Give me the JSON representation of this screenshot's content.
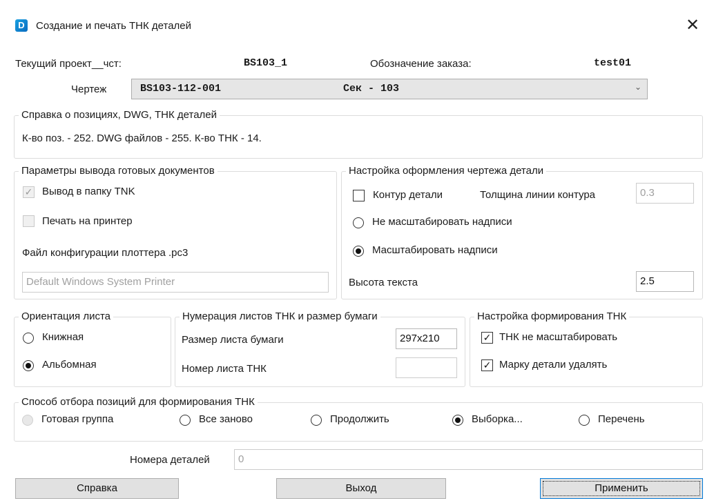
{
  "window": {
    "title": "Создание и печать ТНК деталей",
    "close_glyph": "✕",
    "icon_glyph": "D"
  },
  "project": {
    "current_label": "Текущий проект__чст:",
    "current_value": "BS103_1",
    "order_label": "Обозначение заказа:",
    "order_value": "test01"
  },
  "drawing": {
    "label": "Чертеж",
    "selected_code": "BS103-112-001",
    "selected_section": "Сек - 103",
    "arrow_glyph": "⌄"
  },
  "info": {
    "title": "Справка о позициях, DWG, ТНК деталей",
    "text": "К-во поз. - 252. DWG файлов - 255. К-во ТНК - 14."
  },
  "output": {
    "title": "Параметры вывода готовых документов",
    "folder_label": "Вывод в папку TNK",
    "folder_checked": true,
    "printer_label": "Печать на принтер",
    "printer_checked": false,
    "config_label": "Файл конфигурации плоттера .pc3",
    "config_placeholder": "Default Windows System Printer"
  },
  "drawing_setup": {
    "title": "Настройка оформления чертежа детали",
    "contour_label": "Контур детали",
    "contour_checked": false,
    "thickness_label": "Толщина линии контура",
    "thickness_value": "0.3",
    "no_scale_label": "Не масштабировать надписи",
    "scale_label": "Масштабировать надписи",
    "scale_selected": true,
    "text_height_label": "Высота текста",
    "text_height_value": "2.5"
  },
  "orientation": {
    "title": "Ориентация листа",
    "portrait_label": "Книжная",
    "landscape_label": "Альбомная",
    "selected": "landscape"
  },
  "numbering": {
    "title": "Нумерация листов ТНК и размер бумаги",
    "paper_size_label": "Размер листа бумаги",
    "paper_size_value": "297x210",
    "sheet_number_label": "Номер листа ТНК",
    "sheet_number_value": ""
  },
  "tnk_setup": {
    "title": "Настройка формирования ТНК",
    "no_scale_label": "ТНК не масштабировать",
    "no_scale_checked": true,
    "delete_mark_label": "Марку детали удалять",
    "delete_mark_checked": true
  },
  "selection": {
    "title": "Способ отбора позиций для формирования ТНК",
    "options": [
      {
        "label": "Готовая группа",
        "disabled": true
      },
      {
        "label": "Все заново",
        "disabled": false
      },
      {
        "label": "Продолжить",
        "disabled": false
      },
      {
        "label": "Выборка...",
        "disabled": false
      },
      {
        "label": "Перечень",
        "disabled": false
      }
    ],
    "selected_index": 3
  },
  "parts": {
    "label": "Номера деталей",
    "value": "0"
  },
  "buttons": {
    "help": "Справка",
    "exit": "Выход",
    "apply": "Применить"
  },
  "checkmark_glyph": "✓"
}
